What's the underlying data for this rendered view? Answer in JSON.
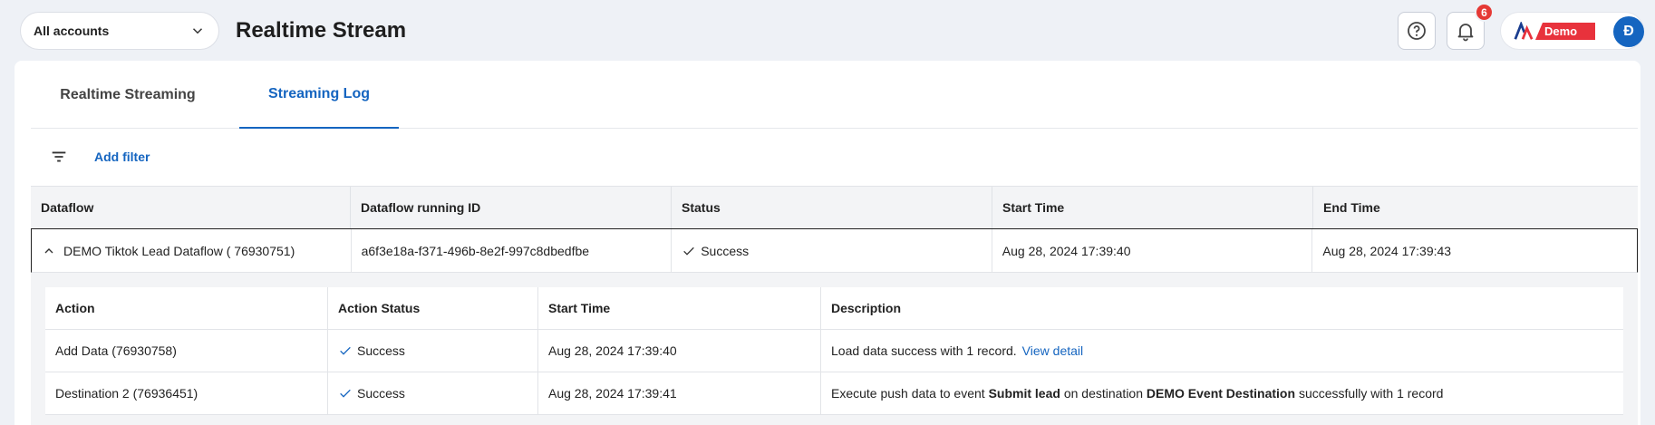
{
  "header": {
    "account_select": "All accounts",
    "title": "Realtime Stream",
    "notification_count": "6",
    "brand_label": "Demo",
    "avatar_initial": "Đ"
  },
  "tabs": [
    {
      "label": "Realtime Streaming",
      "active": false
    },
    {
      "label": "Streaming Log",
      "active": true
    }
  ],
  "filter": {
    "add_label": "Add filter"
  },
  "table": {
    "columns": [
      "Dataflow",
      "Dataflow running ID",
      "Status",
      "Start Time",
      "End Time"
    ],
    "rows": [
      {
        "dataflow": "DEMO Tiktok Lead Dataflow ( 76930751)",
        "running_id": "a6f3e18a-f371-496b-8e2f-997c8dbedfbe",
        "status": "Success",
        "start_time": "Aug 28, 2024 17:39:40",
        "end_time": "Aug 28, 2024 17:39:43",
        "expanded": true
      }
    ]
  },
  "nested": {
    "columns": [
      "Action",
      "Action Status",
      "Start Time",
      "Description"
    ],
    "rows": [
      {
        "action": "Add Data (76930758)",
        "status": "Success",
        "start_time": "Aug 28, 2024 17:39:40",
        "description": "Load data success with 1 record.",
        "link": "View detail"
      },
      {
        "action": "Destination 2 (76936451)",
        "status": "Success",
        "start_time": "Aug 28, 2024 17:39:41",
        "desc_1": "Execute push data to event",
        "desc_event": "Submit lead",
        "desc_2": "on destination",
        "desc_destination": "DEMO Event Destination",
        "desc_3": "successfully with 1 record"
      }
    ]
  },
  "colors": {
    "accent": "#1565c0",
    "badge": "#e53935",
    "brand": "#e8323c",
    "background": "#eef1f6"
  }
}
